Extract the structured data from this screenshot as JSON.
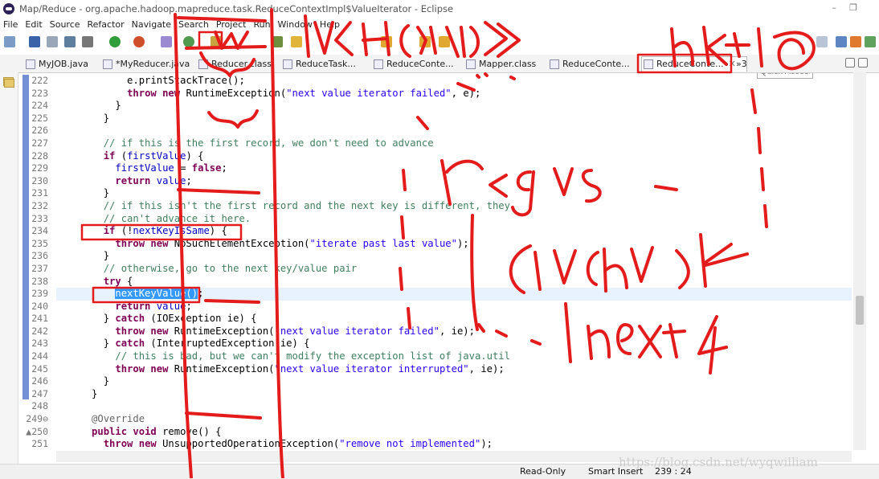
{
  "window": {
    "title": "Map/Reduce - org.apache.hadoop.mapreduce.task.ReduceContextImpl$ValueIterator - Eclipse",
    "minimize": "–",
    "restore": "❐"
  },
  "menu": [
    "File",
    "Edit",
    "Source",
    "Refactor",
    "Navigate",
    "Search",
    "Project",
    "Run",
    "Window",
    "Help"
  ],
  "toolbar": {
    "quick_access_placeholder": "Quick Access"
  },
  "tabs": [
    {
      "label": "MyJOB.java"
    },
    {
      "label": "*MyReducer.java"
    },
    {
      "label": "Reducer.class"
    },
    {
      "label": "ReduceTask..."
    },
    {
      "label": "ReduceConte..."
    },
    {
      "label": "Mapper.class"
    },
    {
      "label": "ReduceConte..."
    },
    {
      "label": "ReduceConte...",
      "close": "✕"
    },
    {
      "label": "»3"
    }
  ],
  "editor": {
    "line_numbers": [
      "222",
      "223",
      "224",
      "225",
      "226",
      "227",
      "228",
      "229",
      "230",
      "231",
      "232",
      "233",
      "234",
      "235",
      "236",
      "237",
      "238",
      "239",
      "240",
      "241",
      "242",
      "243",
      "244",
      "245",
      "246",
      "247",
      "248",
      "249⊖",
      "▲250",
      "251"
    ]
  },
  "status": {
    "mode": "Read-Only",
    "insert": "Smart Insert",
    "position": "239 : 24"
  },
  "watermark": "https://blog.csdn.net/wyqwilliam",
  "colors": {
    "keyword": "#7f0055",
    "string": "#2a00ff",
    "comment": "#3f7f5f",
    "field": "#0000c0",
    "annotation_ink": "#e31b1b",
    "selection": "#3399ff"
  }
}
